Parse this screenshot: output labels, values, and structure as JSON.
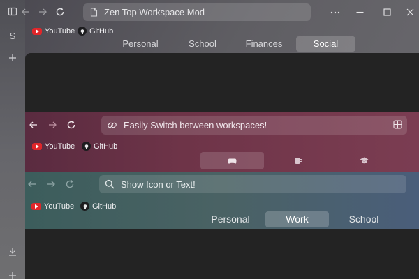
{
  "window": {
    "title": "Zen Top Workspace Mod",
    "menu_icon": "more-horizontal-icon",
    "controls": [
      "minimize-icon",
      "maximize-icon",
      "close-icon"
    ]
  },
  "sidebar": {
    "workspace_letter": "S",
    "add_icon": "plus-icon",
    "download_icon": "download-icon"
  },
  "bookmarks": [
    {
      "label": "YouTube",
      "icon": "youtube-icon"
    },
    {
      "label": "GitHub",
      "icon": "github-icon"
    }
  ],
  "workspaces_top": {
    "tabs": [
      {
        "label": "Personal"
      },
      {
        "label": "School"
      },
      {
        "label": "Finances"
      },
      {
        "label": "Social",
        "active": true
      }
    ]
  },
  "preview_icons": {
    "url_text": "Easily Switch between workspaces!",
    "tabs": [
      {
        "icon": "gamepad-icon",
        "active": true
      },
      {
        "icon": "cup-icon"
      },
      {
        "icon": "graduation-cap-icon"
      }
    ],
    "accent": "#6e3448"
  },
  "preview_text": {
    "url_text": "Show Icon or Text!",
    "tabs": [
      {
        "label": "Personal"
      },
      {
        "label": "Work",
        "active": true
      },
      {
        "label": "School"
      }
    ],
    "accent": "#4a6264"
  }
}
